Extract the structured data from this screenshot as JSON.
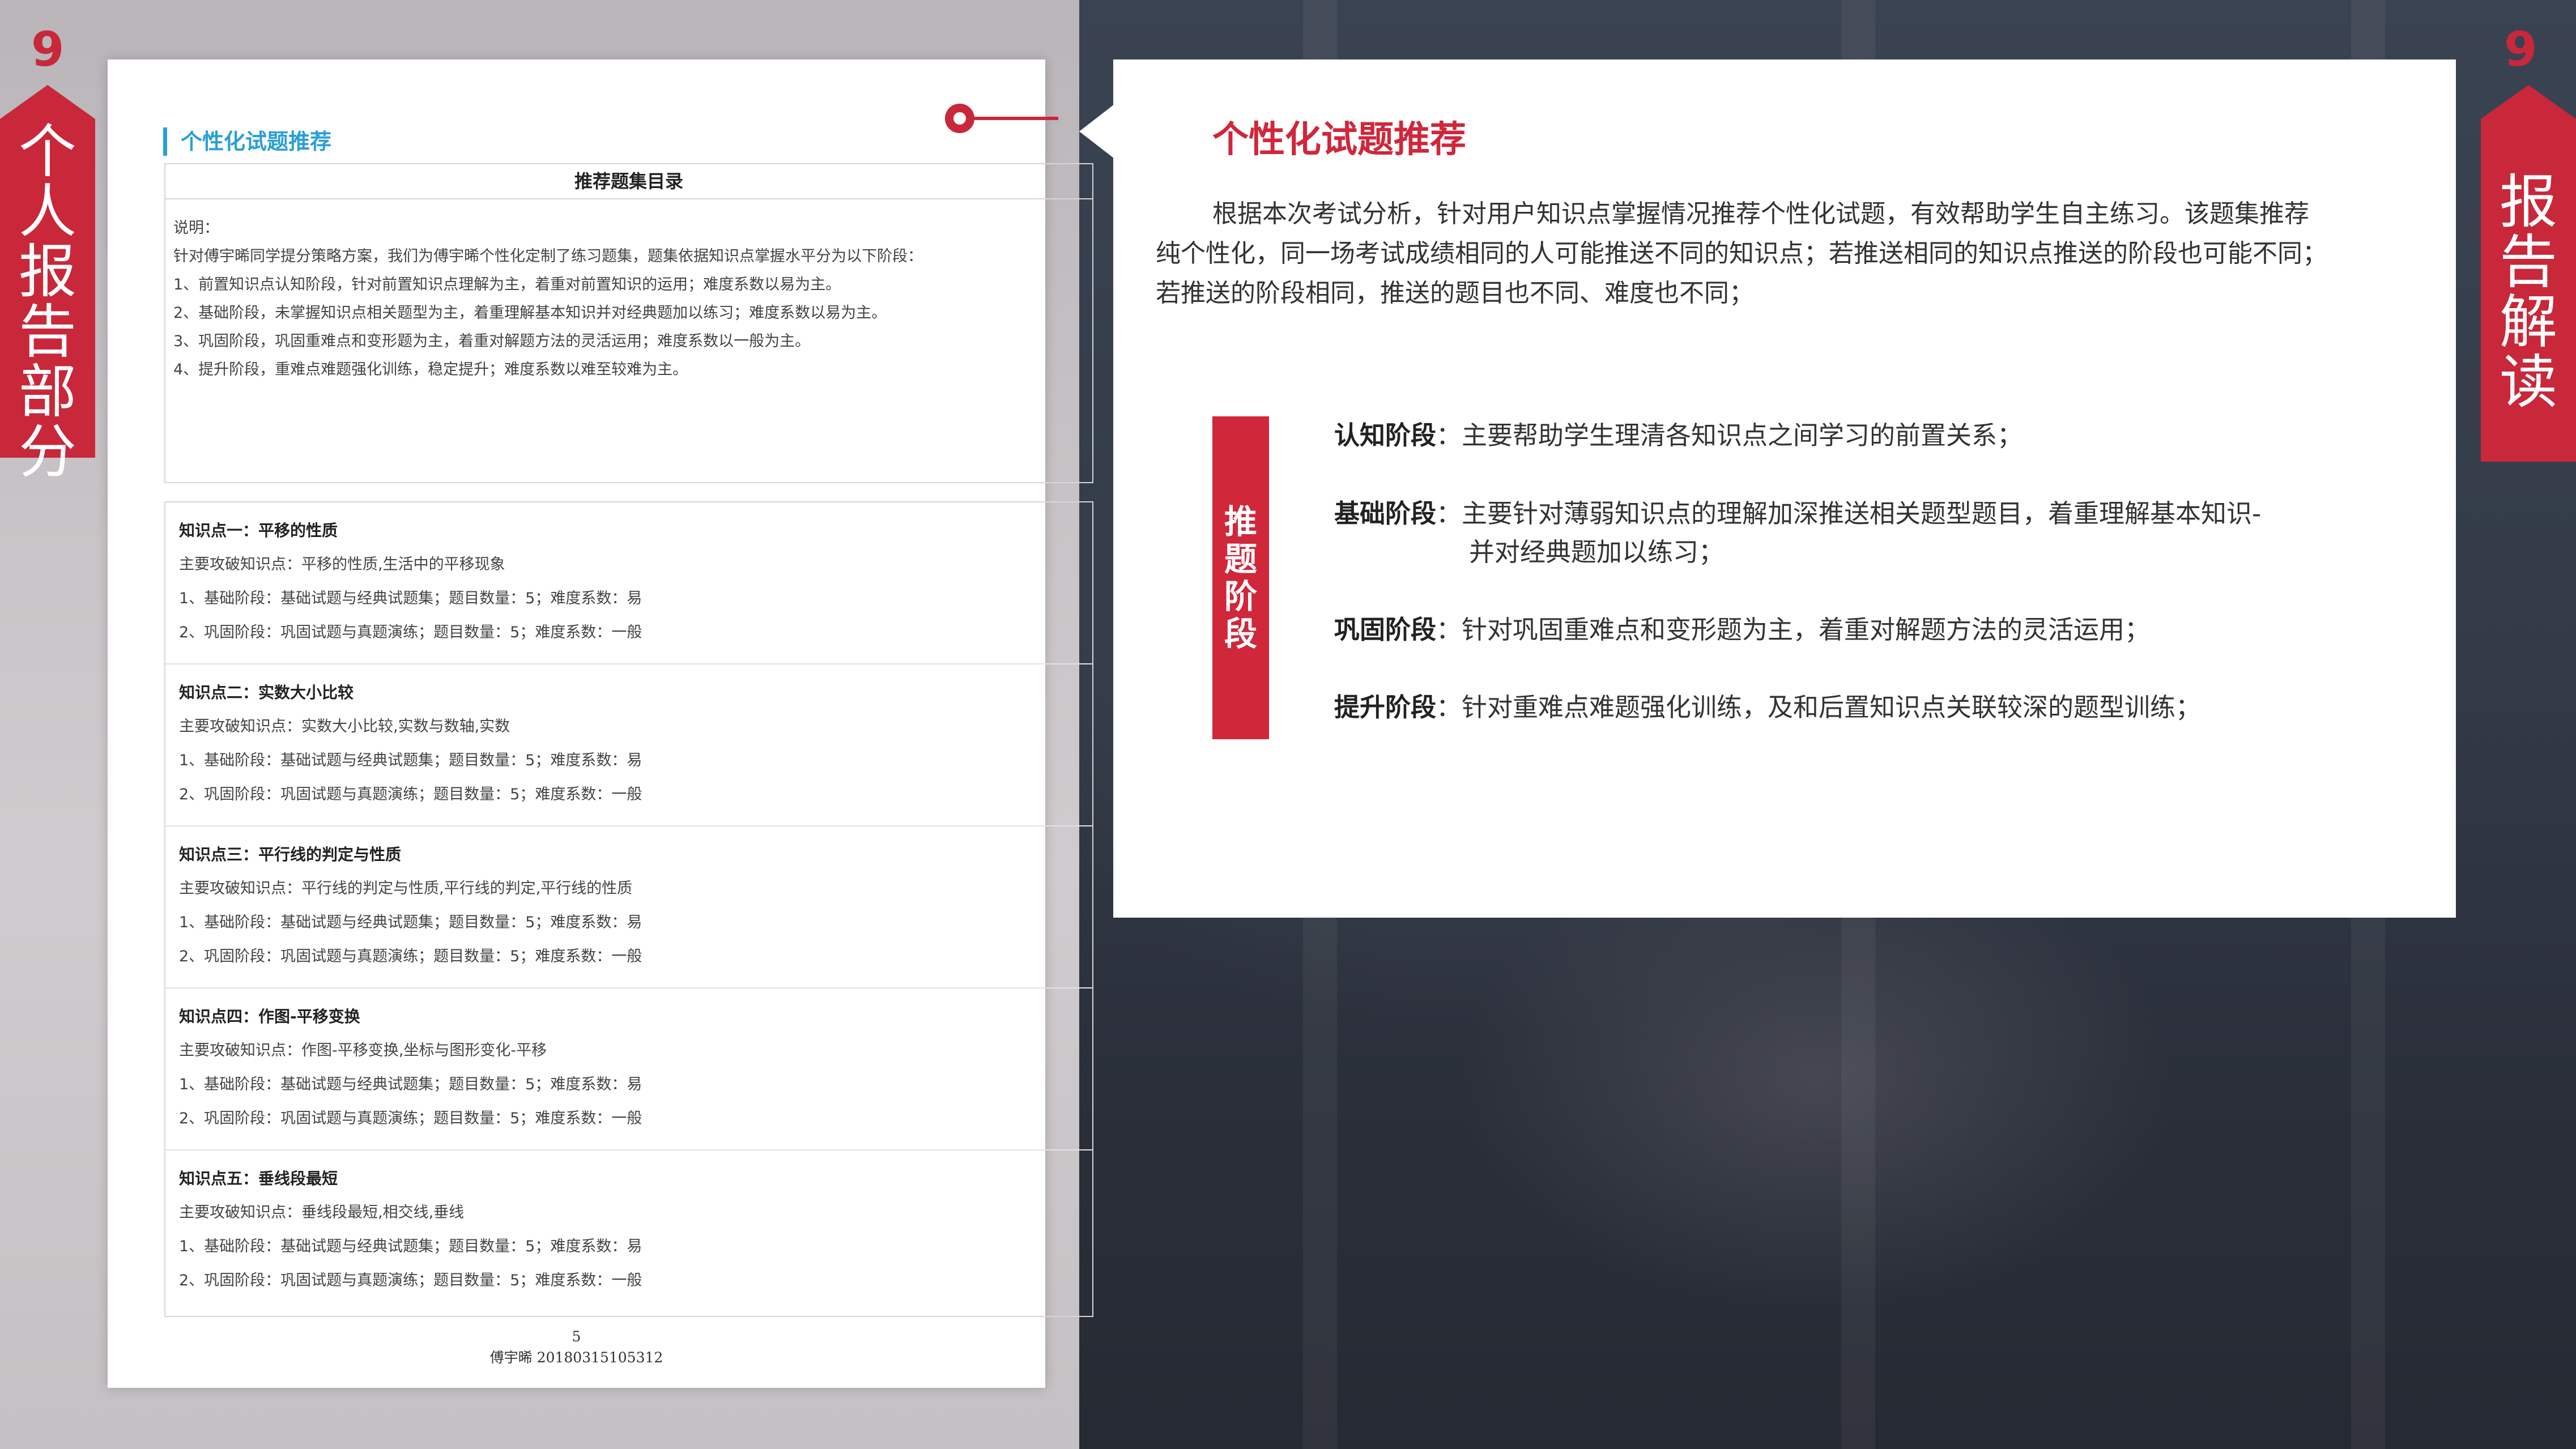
{
  "left_tab": {
    "number": "9",
    "label": "个人报告部分"
  },
  "right_tab": {
    "number": "9",
    "label": "报告解读"
  },
  "document": {
    "section_title": "个性化试题推荐",
    "catalog_title": "推荐题集目录",
    "intro_lines": [
      "说明：",
      "针对傅宇晞同学提分策略方案，我们为傅宇晞个性化定制了练习题集，题集依据知识点掌握水平分为以下阶段：",
      "1、前置知识点认知阶段，针对前置知识点理解为主，着重对前置知识的运用；难度系数以易为主。",
      "2、基础阶段，未掌握知识点相关题型为主，着重理解基本知识并对经典题加以练习；难度系数以易为主。",
      "3、巩固阶段，巩固重难点和变形题为主，着重对解题方法的灵活运用；难度系数以一般为主。",
      "4、提升阶段，重难点难题强化训练，稳定提升；难度系数以难至较难为主。"
    ],
    "knowledge_points": [
      {
        "title": "知识点一：平移的性质",
        "focus": "主要攻破知识点：平移的性质,生活中的平移现象",
        "line1": "1、基础阶段：基础试题与经典试题集；题目数量：5；难度系数：易",
        "line2": "2、巩固阶段：巩固试题与真题演练；题目数量：5；难度系数：一般"
      },
      {
        "title": "知识点二：实数大小比较",
        "focus": "主要攻破知识点：实数大小比较,实数与数轴,实数",
        "line1": "1、基础阶段：基础试题与经典试题集；题目数量：5；难度系数：易",
        "line2": "2、巩固阶段：巩固试题与真题演练；题目数量：5；难度系数：一般"
      },
      {
        "title": "知识点三：平行线的判定与性质",
        "focus": "主要攻破知识点：平行线的判定与性质,平行线的判定,平行线的性质",
        "line1": "1、基础阶段：基础试题与经典试题集；题目数量：5；难度系数：易",
        "line2": "2、巩固阶段：巩固试题与真题演练；题目数量：5；难度系数：一般"
      },
      {
        "title": "知识点四：作图-平移变换",
        "focus": "主要攻破知识点：作图-平移变换,坐标与图形变化-平移",
        "line1": "1、基础阶段：基础试题与经典试题集；题目数量：5；难度系数：易",
        "line2": "2、巩固阶段：巩固试题与真题演练；题目数量：5；难度系数：一般"
      },
      {
        "title": "知识点五：垂线段最短",
        "focus": "主要攻破知识点：垂线段最短,相交线,垂线",
        "line1": "1、基础阶段：基础试题与经典试题集；题目数量：5；难度系数：易",
        "line2": "2、巩固阶段：巩固试题与真题演练；题目数量：5；难度系数：一般"
      }
    ],
    "page_number": "5",
    "footer_id": "傅宇晞 20180315105312"
  },
  "card": {
    "title": "个性化试题推荐",
    "desc_lines": [
      "根据本次考试分析，针对用户知识点掌握情况推荐个性化试题，有效帮助学生自主练习。该题集推荐",
      "纯个性化，同一场考试成绩相同的人可能推送不同的知识点；若推送相同的知识点推送的阶段也可能不同；",
      "若推送的阶段相同，推送的题目也不同、难度也不同；"
    ],
    "stage_bar_label": "推题阶段",
    "stages": [
      {
        "name": "认知阶段",
        "sep": "：",
        "text": "主要帮助学生理清各知识点之间学习的前置关系；",
        "text2": ""
      },
      {
        "name": "基础阶段",
        "sep": "：",
        "text": "主要针对薄弱知识点的理解加深推送相关题型题目，着重理解基本知识-",
        "text2": "并对经典题加以练习；"
      },
      {
        "name": "巩固阶段",
        "sep": "：",
        "text": "针对巩固重难点和变形题为主，着重对解题方法的灵活运用；",
        "text2": ""
      },
      {
        "name": "提升阶段",
        "sep": "：",
        "text": "针对重难点难题强化训练，及和后置知识点关联较深的题型训练；",
        "text2": ""
      }
    ]
  },
  "colors": {
    "accent_red": "#c8283a",
    "title_blue": "#2a9fd6"
  }
}
